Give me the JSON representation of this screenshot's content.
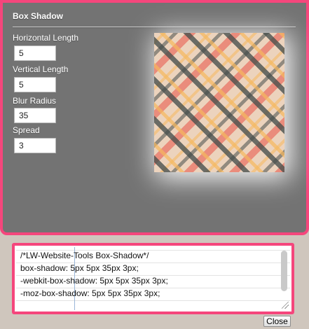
{
  "panel": {
    "title": "Box Shadow",
    "fields": [
      {
        "label": "Horizontal Length",
        "value": "5"
      },
      {
        "label": "Vertical Length",
        "value": "5"
      },
      {
        "label": "Blur Radius",
        "value": "35"
      },
      {
        "label": "Spread",
        "value": "3"
      }
    ]
  },
  "code": {
    "lines": [
      "/*LW-Website-Tools Box-Shadow*/",
      "box-shadow: 5px 5px 35px 3px;",
      "-webkit-box-shadow: 5px 5px 35px 3px;",
      "-moz-box-shadow: 5px 5px 35px 3px;"
    ]
  },
  "close_label": "Close",
  "colors": {
    "accent_border": "#f5467c",
    "panel_background": "#737373",
    "page_background": "#cfc6bd"
  }
}
